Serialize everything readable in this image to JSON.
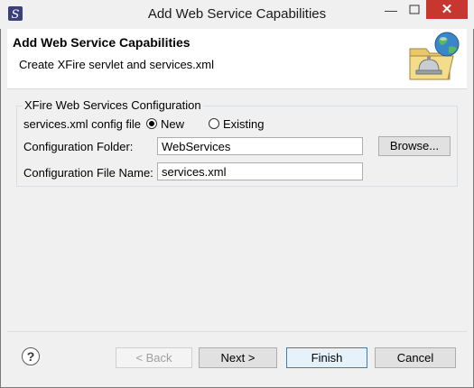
{
  "window": {
    "title": "Add Web Service Capabilities",
    "minimize_glyph": "—",
    "close_glyph": "✕"
  },
  "banner": {
    "title": "Add Web Service Capabilities",
    "description": "Create XFire servlet and services.xml",
    "art_icon": "globe-bell-folder-icon"
  },
  "group": {
    "title": "XFire Web Services Configuration",
    "config_label": "services.xml config file",
    "radio_new": "New",
    "radio_existing": "Existing",
    "selected": "New",
    "folder_label": "Configuration Folder:",
    "folder_value": "WebServices",
    "browse_label": "Browse...",
    "filename_label": "Configuration File Name:",
    "filename_value": "services.xml"
  },
  "footer": {
    "help_glyph": "?",
    "back_label": "< Back",
    "next_label": "Next >",
    "finish_label": "Finish",
    "cancel_label": "Cancel"
  }
}
